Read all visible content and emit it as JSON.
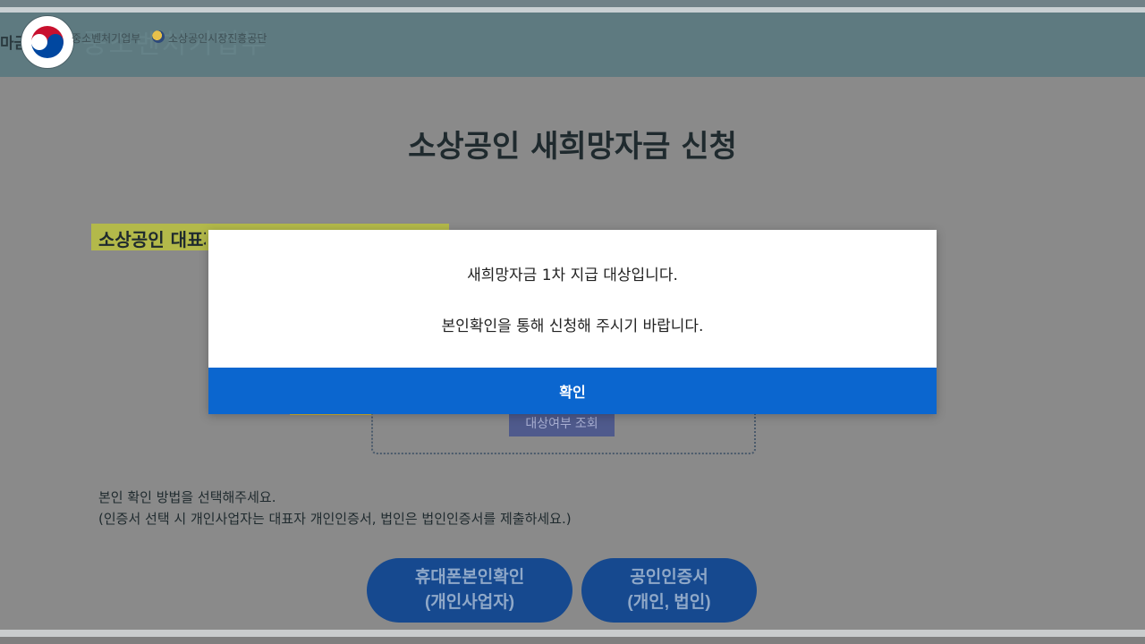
{
  "header": {
    "logo_partial": "마금",
    "ministry": "중소벤처기업부",
    "ministry_ghost": "중소벤처기업부",
    "agency": "소상공인시장진흥공단"
  },
  "page": {
    "title": "소상공인 새희망자금 신청",
    "highlight_text": "소상공인 대표자",
    "check_button": "대상여부 조회"
  },
  "instructions": {
    "line1": "본인 확인 방법을 선택해주세요.",
    "line2": "(인증서 선택 시 개인사업자는 대표자 개인인증서, 법인은 법인인증서를 제출하세요.)"
  },
  "auth_buttons": {
    "phone_line1": "휴대폰본인확인",
    "phone_line2": "(개인사업자)",
    "cert_line1": "공인인증서",
    "cert_line2": "(개인, 법인)"
  },
  "modal": {
    "message1": "새희망자금 1차 지급 대상입니다.",
    "message2": "본인확인을 통해 신청해 주시기 바랍니다.",
    "ok_label": "확인"
  },
  "colors": {
    "modal_button": "#0b66cf",
    "auth_button": "#16498f",
    "highlight": "#b3b94a",
    "header": "#5e7a80"
  }
}
